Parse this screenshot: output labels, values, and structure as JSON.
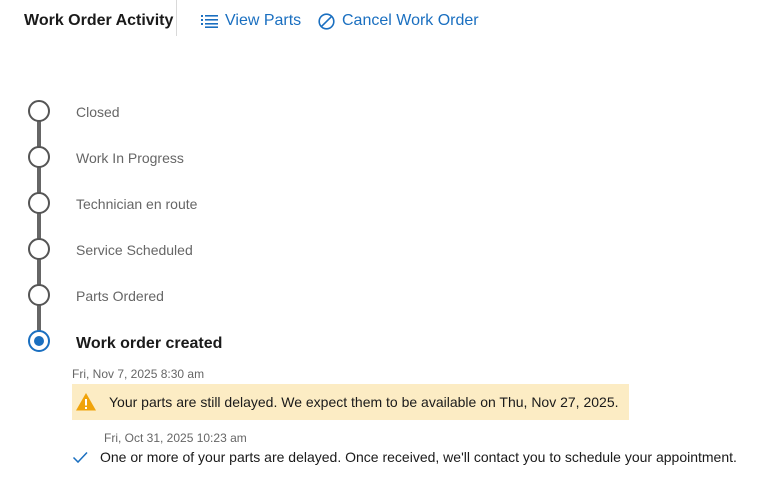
{
  "header": {
    "title": "Work Order Activity",
    "actions": [
      {
        "label": "View Parts",
        "icon": "list-icon"
      },
      {
        "label": "Cancel Work Order",
        "icon": "cancel-circle-icon"
      }
    ]
  },
  "colors": {
    "accent": "#1a6fc0",
    "alert_background": "#fcecc4",
    "warning": "#f0a30a"
  },
  "timeline": {
    "steps": [
      {
        "label": "Closed",
        "status": "pending"
      },
      {
        "label": "Work In Progress",
        "status": "pending"
      },
      {
        "label": "Technician en route",
        "status": "pending"
      },
      {
        "label": "Service Scheduled",
        "status": "pending"
      },
      {
        "label": "Parts Ordered",
        "status": "pending"
      },
      {
        "label": "Work order created",
        "status": "current"
      }
    ],
    "updates": [
      {
        "timestamp": "Fri, Nov 7, 2025 8:30 am",
        "message": "Your parts are still delayed. We expect them to be available on Thu, Nov 27, 2025.",
        "icon": "warning-icon"
      },
      {
        "timestamp": "Fri, Oct 31, 2025 10:23 am",
        "message": "One or more of your parts are delayed. Once received, we'll contact you to schedule your appointment.",
        "icon": "check-icon"
      }
    ]
  }
}
